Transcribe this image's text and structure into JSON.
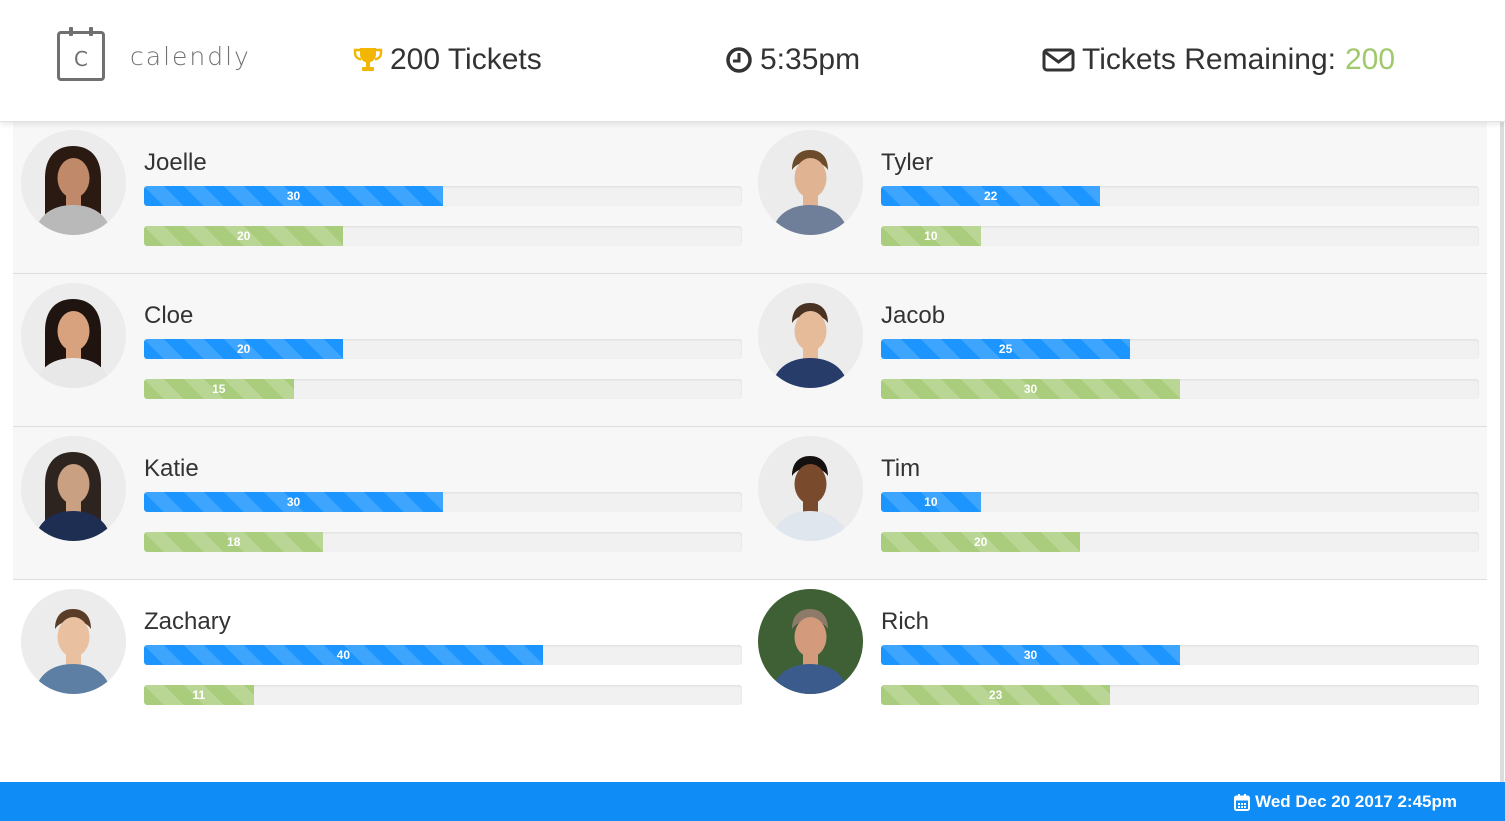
{
  "header": {
    "logo_text": "calendly",
    "logo_letter": "C",
    "tickets_label": "200 Tickets",
    "time_label": "5:35pm",
    "remaining_label": "Tickets Remaining:",
    "remaining_value": "200",
    "icons": [
      "trophy-icon",
      "clock-icon",
      "envelope-icon"
    ]
  },
  "colors": {
    "primary_bar": "#1c95ff",
    "secondary_bar": "#aacd7d",
    "remaining_accent": "#9fc96b",
    "footer": "#0f8cf6",
    "trophy": "#f2b600"
  },
  "board": {
    "max_value": 60,
    "rows": [
      {
        "left": {
          "name": "Joelle",
          "primary": 30,
          "secondary": 20,
          "avatar": "photo-woman-curly-dark-hair"
        },
        "right": {
          "name": "Tyler",
          "primary": 22,
          "secondary": 10,
          "avatar": "photo-man-short-hair"
        }
      },
      {
        "left": {
          "name": "Cloe",
          "primary": 20,
          "secondary": 15,
          "avatar": "photo-woman-long-dark-hair"
        },
        "right": {
          "name": "Jacob",
          "primary": 25,
          "secondary": 30,
          "avatar": "photo-man-glasses"
        }
      },
      {
        "left": {
          "name": "Katie",
          "primary": 30,
          "secondary": 18,
          "avatar": "photo-woman-glasses"
        },
        "right": {
          "name": "Tim",
          "primary": 10,
          "secondary": 20,
          "avatar": "photo-man-dark-skin"
        }
      },
      {
        "left": {
          "name": "Zachary",
          "primary": 40,
          "secondary": 11,
          "avatar": "photo-man-checked-shirt"
        },
        "right": {
          "name": "Rich",
          "primary": 30,
          "secondary": 23,
          "avatar": "photo-man-outdoor"
        }
      }
    ]
  },
  "footer": {
    "date_label": "Wed Dec 20 2017 2:45pm",
    "icon": "calendar-icon"
  }
}
